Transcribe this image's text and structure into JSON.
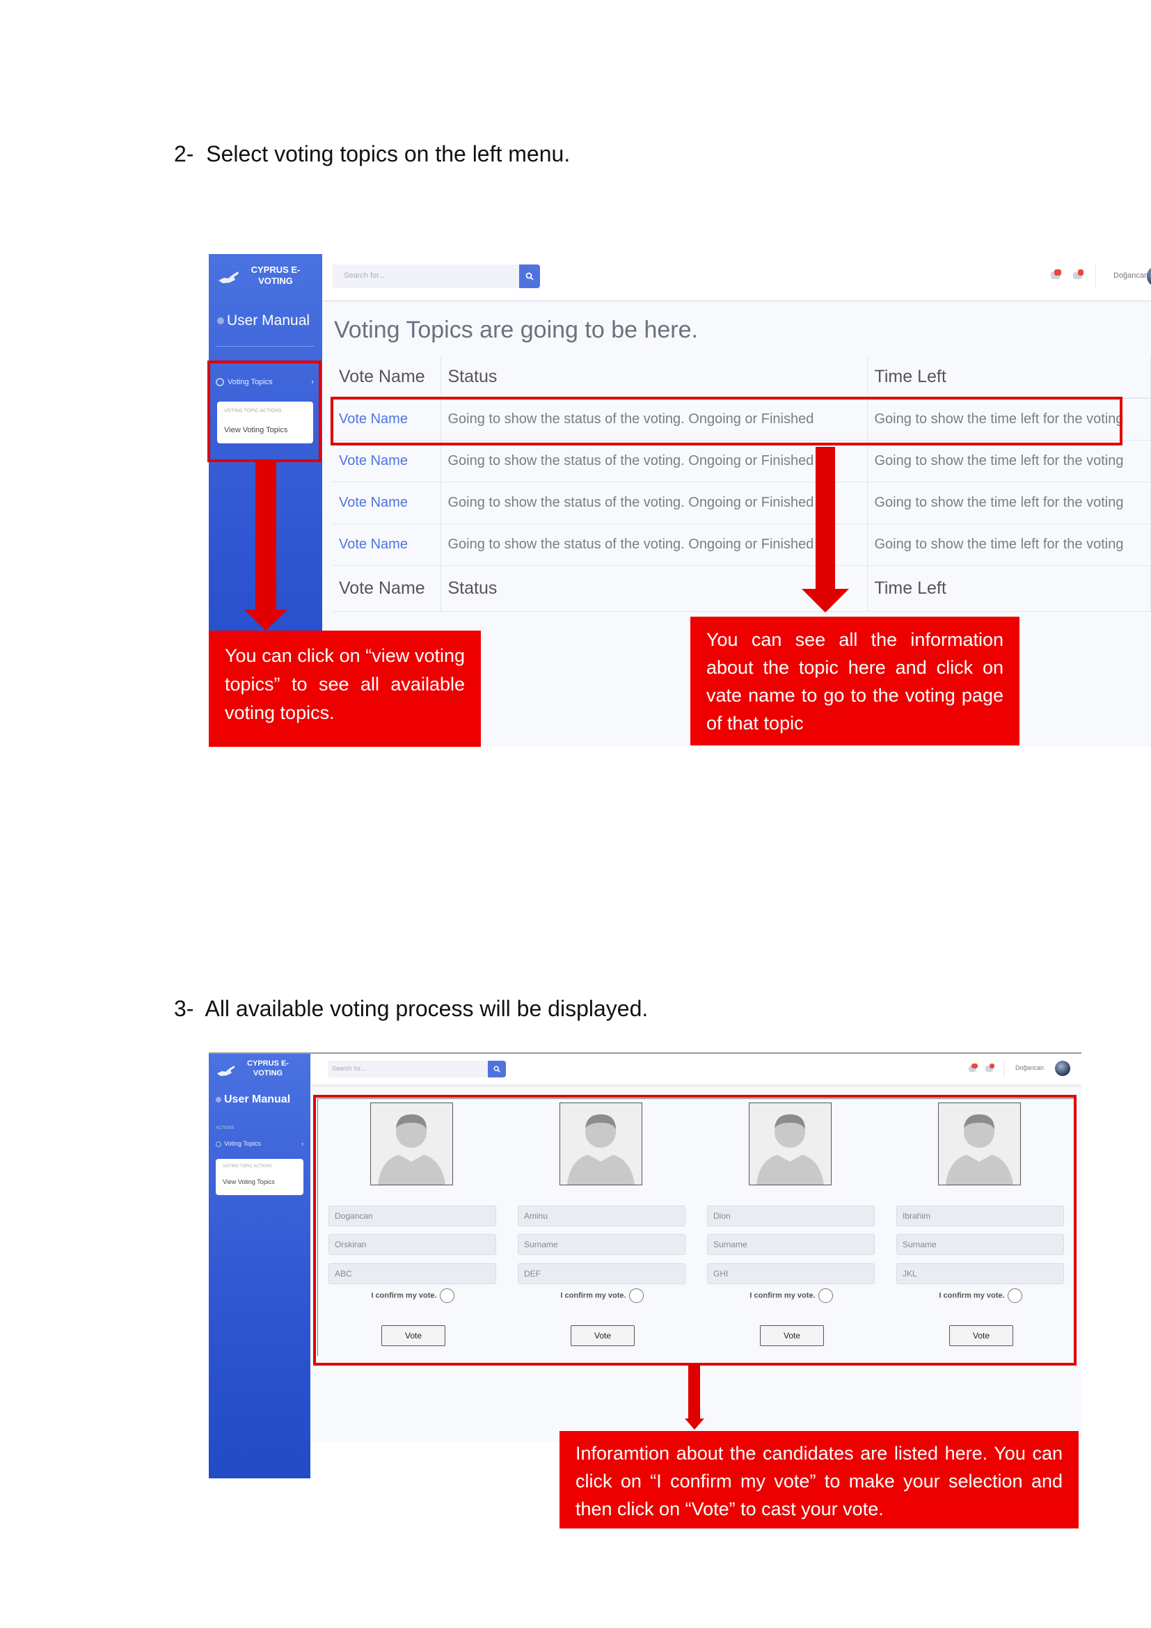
{
  "step2": {
    "number": "2-",
    "text": "Select voting topics on the left menu."
  },
  "step3": {
    "number": "3-",
    "text": "All available voting process will be displayed."
  },
  "app": {
    "brand_line1": "CYPRUS E-",
    "brand_line2": "VOTING",
    "sidebar_heading": "User Manual",
    "actions_label": "ACTIONS",
    "menu_item": "Voting Topics",
    "submenu_header": "VOTING TOPIC ACTIONS",
    "submenu_item": "View Voting Topics",
    "search_placeholder": "Search for...",
    "username": "Doğancan",
    "alerts_badge": "3+",
    "messages_badge": "7"
  },
  "topics_page": {
    "title": "Voting Topics are going to be here.",
    "columns": [
      "Vote Name",
      "Status",
      "Time Left"
    ],
    "rows": [
      [
        "Vote Name",
        "Going to show the status of the voting. Ongoing or Finished",
        "Going to show the time left for the voting"
      ],
      [
        "Vote Name",
        "Going to show the status of the voting. Ongoing or Finished",
        "Going to show the time left for the voting"
      ],
      [
        "Vote Name",
        "Going to show the status of the voting. Ongoing or Finished",
        "Going to show the time left for the voting"
      ],
      [
        "Vote Name",
        "Going to show the status of the voting. Ongoing or Finished",
        "Going to show the time left for the voting"
      ]
    ],
    "footer": [
      "Vote Name",
      "Status",
      "Time Left"
    ]
  },
  "callouts": {
    "left_2": "You can click on “view voting topics” to see all available voting topics.",
    "right_2": "You can see all the information about the topic here and click on vate name to go to the voting page of that topic",
    "bottom_3": "Inforamtion about the candidates are listed here. You can click on “I confirm my vote” to make your selection and then click on “Vote” to cast your vote."
  },
  "candidates": [
    {
      "name": "Dogancan",
      "surname": "Orskiran",
      "party": "ABC",
      "confirm": "I confirm my vote.",
      "vote": "Vote"
    },
    {
      "name": "Aminu",
      "surname": "Surname",
      "party": "DEF",
      "confirm": "I confirm my vote.",
      "vote": "Vote"
    },
    {
      "name": "Dion",
      "surname": "Surname",
      "party": "GHI",
      "confirm": "I confirm my vote.",
      "vote": "Vote"
    },
    {
      "name": "Ibrahim",
      "surname": "Surname",
      "party": "JKL",
      "confirm": "I confirm my vote.",
      "vote": "Vote"
    }
  ],
  "colors": {
    "annotation_red": "#e00000",
    "sidebar_blue": "#2f55d2",
    "link_blue": "#4e73df"
  }
}
